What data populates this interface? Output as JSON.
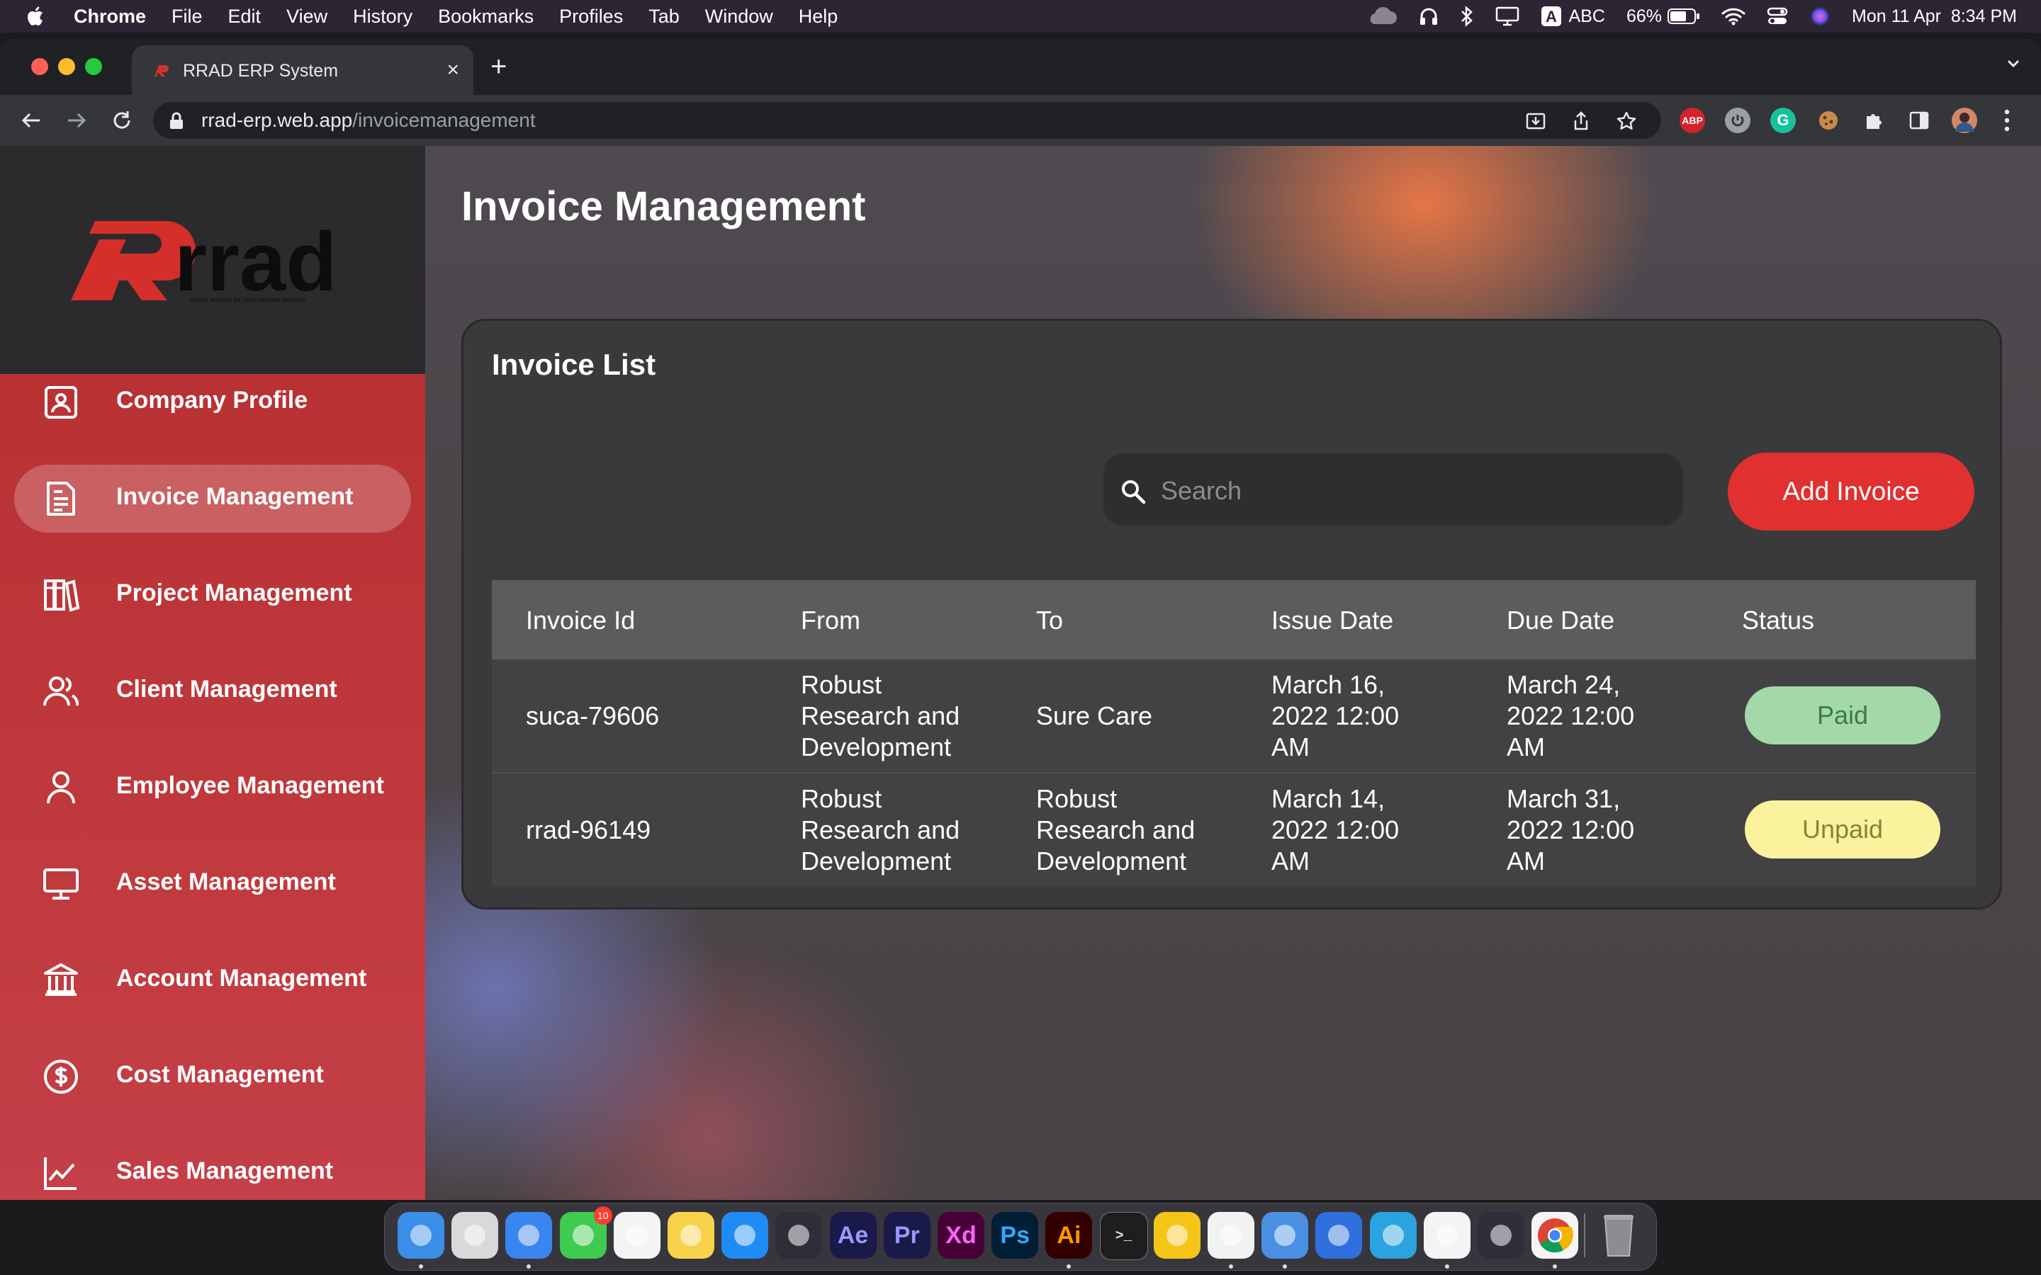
{
  "menubar": {
    "items": [
      "Chrome",
      "File",
      "Edit",
      "View",
      "History",
      "Bookmarks",
      "Profiles",
      "Tab",
      "Window",
      "Help"
    ],
    "input_source": "ABC",
    "battery": "66%",
    "datetime": "Mon 11 Apr  8:34 PM"
  },
  "browser": {
    "tab_title": "RRAD ERP System",
    "url_host": "rrad-erp.web.app",
    "url_path": "/invoicemanagement",
    "extensions": [
      "ABP"
    ]
  },
  "sidebar": {
    "brand": "rrad",
    "tagline": "simple solution for your complex problem",
    "items": [
      {
        "label": "Company Profile",
        "icon": "company-profile-icon"
      },
      {
        "label": "Invoice Management",
        "icon": "invoice-icon",
        "active": true
      },
      {
        "label": "Project Management",
        "icon": "project-icon"
      },
      {
        "label": "Client Management",
        "icon": "clients-icon"
      },
      {
        "label": "Employee Management",
        "icon": "employee-icon"
      },
      {
        "label": "Asset Management",
        "icon": "monitor-icon"
      },
      {
        "label": "Account Management",
        "icon": "bank-icon"
      },
      {
        "label": "Cost Management",
        "icon": "dollar-icon"
      },
      {
        "label": "Sales Management",
        "icon": "chart-icon"
      }
    ]
  },
  "main": {
    "title": "Invoice Management",
    "card_title": "Invoice List",
    "search_placeholder": "Search",
    "add_button": "Add Invoice",
    "columns": [
      "Invoice Id",
      "From",
      "To",
      "Issue Date",
      "Due Date",
      "Status"
    ],
    "rows": [
      {
        "id": "suca-79606",
        "from": [
          "Robust",
          "Research and",
          "Development"
        ],
        "to": [
          "Sure Care"
        ],
        "issue": [
          "March 16,",
          "2022 12:00",
          "AM"
        ],
        "due": [
          "March 24,",
          "2022 12:00",
          "AM"
        ],
        "status": "Paid"
      },
      {
        "id": "rrad-96149",
        "from": [
          "Robust",
          "Research and",
          "Development"
        ],
        "to": [
          "Robust",
          "Research and",
          "Development"
        ],
        "issue": [
          "March 14,",
          "2022 12:00",
          "AM"
        ],
        "due": [
          "March 31,",
          "2022 12:00",
          "AM"
        ],
        "status": "Unpaid"
      }
    ]
  },
  "colors": {
    "accent": "#e0302f",
    "sidebar": "#c03a3e",
    "paid_bg": "#a3d9a8",
    "paid_text": "#3e7a48",
    "unpaid_bg": "#fbf29d",
    "unpaid_text": "#8a8332"
  },
  "dock": {
    "apps": [
      {
        "name": "finder-icon",
        "glyph": "",
        "bg": "#3b8ee8"
      },
      {
        "name": "launchpad-icon",
        "glyph": "",
        "bg": "#d9d9d9"
      },
      {
        "name": "safari-icon",
        "glyph": "",
        "bg": "#3a86f0"
      },
      {
        "name": "messages-icon",
        "glyph": "",
        "bg": "#3ecb4f",
        "badge": "10"
      },
      {
        "name": "photos-icon",
        "glyph": "",
        "bg": "#f4f4f4"
      },
      {
        "name": "notes-icon",
        "glyph": "",
        "bg": "#f7d24a"
      },
      {
        "name": "app-store-icon",
        "glyph": "",
        "bg": "#1f8cf5"
      },
      {
        "name": "davinci-resolve-icon",
        "glyph": "",
        "bg": "#2e2e38"
      },
      {
        "name": "after-effects-icon",
        "glyph": "Ae",
        "bg": "#1a1a4a",
        "fg": "#9999ff"
      },
      {
        "name": "premiere-icon",
        "glyph": "Pr",
        "bg": "#1a1a4a",
        "fg": "#9999ff"
      },
      {
        "name": "xd-icon",
        "glyph": "Xd",
        "bg": "#470137",
        "fg": "#ff61f6"
      },
      {
        "name": "photoshop-icon",
        "glyph": "Ps",
        "bg": "#001e36",
        "fg": "#31a8ff"
      },
      {
        "name": "illustrator-icon",
        "glyph": "Ai",
        "bg": "#330000",
        "fg": "#ff9a00"
      },
      {
        "name": "terminal-icon",
        "glyph": "",
        "bg": "#1e1e1e"
      },
      {
        "name": "miro-icon",
        "glyph": "",
        "bg": "#f5c518"
      },
      {
        "name": "vscode-icon",
        "glyph": "",
        "bg": "#f2f2f2"
      },
      {
        "name": "xcode-instruments-icon",
        "glyph": "",
        "bg": "#4a90e2"
      },
      {
        "name": "xcode-icon",
        "glyph": "",
        "bg": "#2f6fde"
      },
      {
        "name": "telegram-icon",
        "glyph": "",
        "bg": "#2aa3df"
      },
      {
        "name": "slack-icon",
        "glyph": "",
        "bg": "#f4f4f4"
      },
      {
        "name": "obs-icon",
        "glyph": "",
        "bg": "#302e3a"
      },
      {
        "name": "chrome-icon",
        "glyph": "",
        "bg": "#f4f4f4"
      },
      {
        "name": "trash-icon",
        "glyph": "",
        "bg": "transparent"
      }
    ]
  }
}
